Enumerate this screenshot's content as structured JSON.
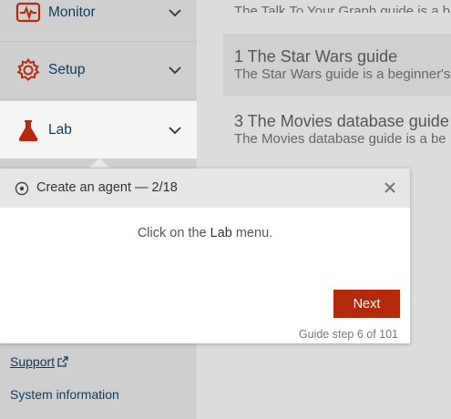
{
  "sidebar": {
    "items": [
      {
        "label": "Monitor",
        "icon": "monitor-pulse-icon"
      },
      {
        "label": "Setup",
        "icon": "gear-icon"
      },
      {
        "label": "Lab",
        "icon": "flask-icon",
        "active": true
      }
    ],
    "support_label": "Support",
    "sysinfo_label": "System information"
  },
  "guides": [
    {
      "title": "",
      "desc": "The Talk To Your Graph guide is a b"
    },
    {
      "title": "1 The Star Wars guide",
      "desc": "The Star Wars guide is a beginner's"
    },
    {
      "title": "3 The Movies database guide",
      "desc": "The Movies database guide is a be"
    }
  ],
  "popover": {
    "title": "Create an agent — 2/18",
    "instruction_prefix": "Click on the ",
    "instruction_bold": "Lab",
    "instruction_suffix": " menu.",
    "next_label": "Next",
    "step_text": "Guide step 6 of 101"
  },
  "colors": {
    "accent": "#b5290d",
    "nav_text": "#0e3a5b",
    "sidebar_bg": "#cfcfcf",
    "content_bg": "#dddddd",
    "active_bg": "#f5f5f5"
  }
}
